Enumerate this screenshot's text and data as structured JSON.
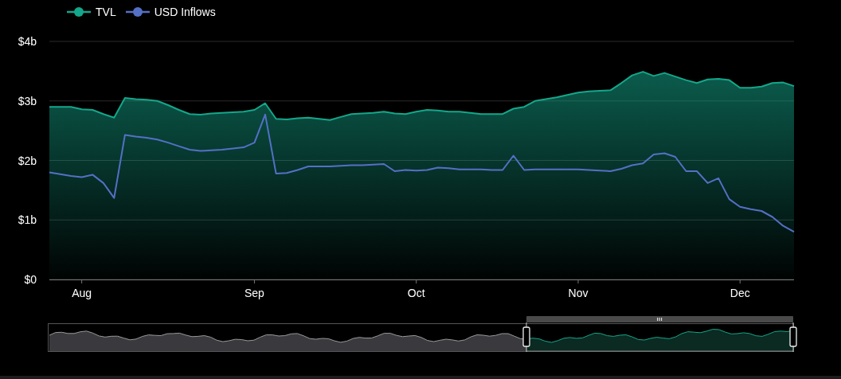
{
  "chart_data": {
    "type": "area",
    "grid": true,
    "ylim": [
      0,
      4
    ],
    "yticks": [
      {
        "value": 0,
        "label": "$0"
      },
      {
        "value": 1,
        "label": "$1b"
      },
      {
        "value": 2,
        "label": "$2b"
      },
      {
        "value": 3,
        "label": "$3b"
      },
      {
        "value": 4,
        "label": "$4b"
      }
    ],
    "categories": [
      null,
      null,
      null,
      "Aug",
      null,
      null,
      null,
      null,
      null,
      null,
      null,
      null,
      null,
      null,
      null,
      null,
      null,
      null,
      null,
      "Sep",
      null,
      null,
      null,
      null,
      null,
      null,
      null,
      null,
      null,
      null,
      null,
      null,
      null,
      null,
      "Oct",
      null,
      null,
      null,
      null,
      null,
      null,
      null,
      null,
      null,
      null,
      null,
      null,
      null,
      null,
      "Nov",
      null,
      null,
      null,
      null,
      null,
      null,
      null,
      null,
      null,
      null,
      null,
      null,
      null,
      null,
      "Dec",
      null,
      null,
      null,
      null,
      null
    ],
    "series": [
      {
        "name": "TVL",
        "color": "#14a78b",
        "type": "area",
        "values": [
          2.9,
          2.9,
          2.9,
          2.86,
          2.85,
          2.78,
          2.72,
          3.05,
          3.03,
          3.02,
          3.0,
          2.93,
          2.85,
          2.78,
          2.77,
          2.79,
          2.8,
          2.81,
          2.82,
          2.85,
          2.96,
          2.7,
          2.69,
          2.71,
          2.72,
          2.7,
          2.68,
          2.73,
          2.78,
          2.79,
          2.8,
          2.82,
          2.79,
          2.78,
          2.82,
          2.85,
          2.84,
          2.82,
          2.82,
          2.8,
          2.78,
          2.78,
          2.78,
          2.87,
          2.9,
          3.0,
          3.03,
          3.06,
          3.1,
          3.14,
          3.16,
          3.17,
          3.18,
          3.3,
          3.43,
          3.49,
          3.42,
          3.47,
          3.41,
          3.35,
          3.3,
          3.36,
          3.37,
          3.35,
          3.22,
          3.22,
          3.24,
          3.3,
          3.31,
          3.25
        ]
      },
      {
        "name": "USD Inflows",
        "color": "#5470c6",
        "type": "line",
        "values": [
          1.8,
          1.77,
          1.74,
          1.72,
          1.76,
          1.62,
          1.37,
          2.43,
          2.4,
          2.38,
          2.35,
          2.3,
          2.24,
          2.18,
          2.16,
          2.17,
          2.18,
          2.2,
          2.22,
          2.3,
          2.77,
          1.78,
          1.79,
          1.84,
          1.9,
          1.9,
          1.9,
          1.91,
          1.92,
          1.92,
          1.93,
          1.94,
          1.82,
          1.84,
          1.83,
          1.84,
          1.88,
          1.87,
          1.85,
          1.85,
          1.85,
          1.84,
          1.84,
          2.08,
          1.84,
          1.85,
          1.85,
          1.85,
          1.85,
          1.85,
          1.84,
          1.83,
          1.82,
          1.86,
          1.92,
          1.95,
          2.1,
          2.12,
          2.06,
          1.82,
          1.82,
          1.62,
          1.7,
          1.35,
          1.22,
          1.18,
          1.15,
          1.05,
          0.9,
          0.8
        ]
      }
    ]
  }
}
